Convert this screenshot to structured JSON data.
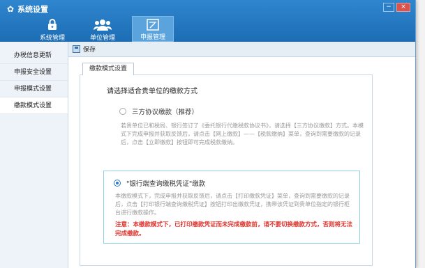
{
  "window": {
    "title": "系统设置",
    "minimize": "−",
    "close": "×"
  },
  "tabs": [
    {
      "label": "系统管理",
      "icon": "lock-icon"
    },
    {
      "label": "单位管理",
      "icon": "users-icon"
    },
    {
      "label": "申报管理",
      "icon": "declare-icon"
    }
  ],
  "sidebar": {
    "items": [
      {
        "label": "办税信息更新"
      },
      {
        "label": "申报安全设置"
      },
      {
        "label": "申报模式设置"
      },
      {
        "label": "缴款模式设置"
      }
    ]
  },
  "toolbar": {
    "save_label": "保存"
  },
  "main": {
    "tab_label": "缴款模式设置",
    "heading": "请选择适合贵单位的缴款方式",
    "option1": {
      "title": "三方协议缴款（推荐）",
      "desc": "若贵单位已和税局、银行签订了《委托银行代缴税款协议书》，请选择【三方协议缴款】方式。本模式下完成申报并获取反馈后，请点击【网上缴款】——【税款缴纳】菜单，查询到需要缴款的记录后，点击【立即缴款】按钮即可完成税款缴纳。"
    },
    "option2": {
      "title": "\"银行端查询缴税凭证\"缴款",
      "desc": "本缴款模式下，完成申报并获取反馈后，请点击【打印缴款凭证】菜单，查询到需要缴款的记录后，点击【打印银行端查询缴税凭证】按钮打印出缴款凭证，携带该凭证到贵单位指定的银行柜台进行缴款操作。",
      "warning": "注意：本缴款模式下，已打印缴款凭证而未完成缴款前，请不要切换缴款方式，否则将无法完成缴款。"
    }
  }
}
